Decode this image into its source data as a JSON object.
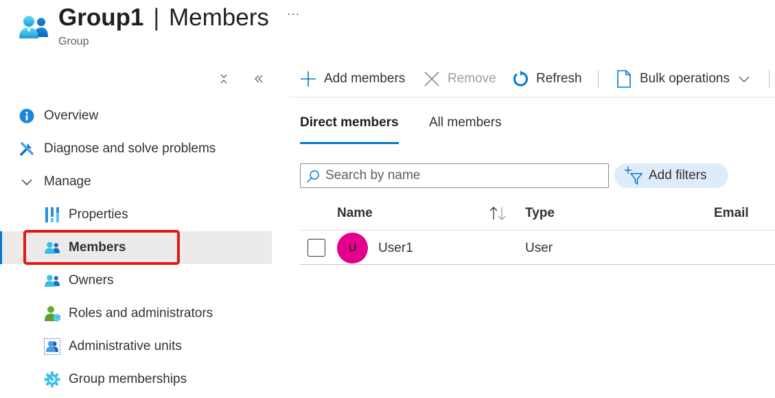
{
  "header": {
    "title_name": "Group1",
    "title_separator": "|",
    "title_section": "Members",
    "subtitle": "Group",
    "more_label": "···",
    "icon": "group-icon"
  },
  "sidebar": {
    "controls": [
      {
        "icon": "collapse-vertical-icon",
        "label": "Collapse all"
      },
      {
        "icon": "double-chevron-left-icon",
        "label": "Collapse sidebar"
      }
    ],
    "items": [
      {
        "label": "Overview",
        "icon": "info-icon",
        "level": 0
      },
      {
        "label": "Diagnose and solve problems",
        "icon": "wrench-screwdriver-icon",
        "level": 0
      },
      {
        "label": "Manage",
        "icon": "chevron-down-icon",
        "level": 0
      },
      {
        "label": "Properties",
        "icon": "properties-icon",
        "level": 1
      },
      {
        "label": "Members",
        "icon": "members-icon",
        "level": 1,
        "active": true
      },
      {
        "label": "Owners",
        "icon": "owners-icon",
        "level": 1
      },
      {
        "label": "Roles and administrators",
        "icon": "roles-icon",
        "level": 1
      },
      {
        "label": "Administrative units",
        "icon": "admin-units-icon",
        "level": 1
      },
      {
        "label": "Group memberships",
        "icon": "gear-icon",
        "level": 1
      }
    ]
  },
  "toolbar": {
    "add_members": "Add members",
    "remove": "Remove",
    "refresh": "Refresh",
    "bulk_operations": "Bulk operations"
  },
  "tabs": [
    {
      "label": "Direct members",
      "active": true
    },
    {
      "label": "All members",
      "active": false
    }
  ],
  "search": {
    "placeholder": "Search by name",
    "value": ""
  },
  "filters": {
    "label": "Add filters"
  },
  "table": {
    "columns": [
      "Name",
      "Type",
      "Email"
    ],
    "rows": [
      {
        "initial": "U",
        "name": "User1",
        "type": "User",
        "email": "",
        "avatar_color": "#e3008c"
      }
    ]
  },
  "colors": {
    "accent": "#0078d4",
    "highlight": "#e3190f",
    "active_bg": "#edebe9",
    "filter_bg": "#deecf9"
  }
}
